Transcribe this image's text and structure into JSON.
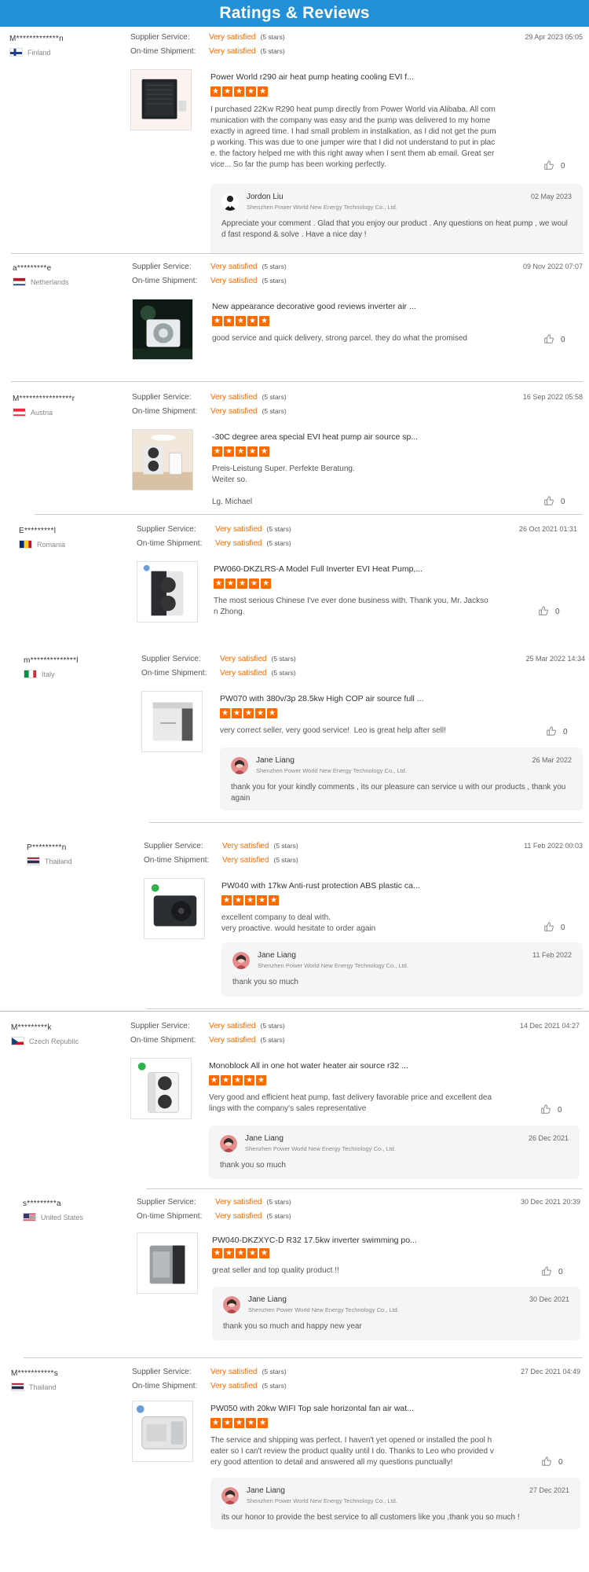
{
  "header": {
    "title": "Ratings & Reviews"
  },
  "common": {
    "supplier_label": "Supplier Service:",
    "shipment_label": "On-time Shipment:",
    "rating_value": "Very satisfied",
    "rating_stars": "(5 stars)",
    "star_count": 5
  },
  "reviews": [
    {
      "user": "M*************n",
      "country": "Finland",
      "date": "29 Apr 2023 05:05",
      "product": "Power World r290 air heat pump heating cooling EVI f...",
      "text": "I purchased 22Kw R290 heat pump directly from Power World via Alibaba. All communication with the company was easy and the pump was delivered to my home exactly in agreed time. I had small problem in instalkation, as I did not get the pump working. This was due to one jumper wire that I did not understand to put in place. the factory helped me with this right away when I sent them ab email. Great service... So far the pump has been working perfectly.",
      "likes": "0",
      "reply": {
        "name": "Jordon Liu",
        "company": "Shenzhen Power World New Energy Technology Co., Ltd.",
        "date": "02 May 2023",
        "text": "Appreciate your comment . Glad that you enjoy our product . Any questions on heat pump , we would fast respond & solve . Have a nice day !"
      }
    },
    {
      "user": "a*********e",
      "country": "Netherlands",
      "date": "09 Nov 2022 07:07",
      "product": "New appearance decorative good reviews inverter air ...",
      "text": "good service and quick delivery, strong parcel. they do what the promised",
      "likes": "0"
    },
    {
      "user": "M****************r",
      "country": "Austria",
      "date": "16 Sep 2022 05:58",
      "product": "-30C degree area special EVI heat pump air source sp...",
      "text": "Preis-Leistung Super. Perfekte Beratung.\nWeiter so.\n\nLg. Michael",
      "likes": "0"
    },
    {
      "user": "E*********l",
      "country": "Romania",
      "date": "26 Oct 2021 01:31",
      "product": "PW060-DKZLRS-A Model Full Inverter EVI Heat Pump,...",
      "text": "The most serious Chinese I've ever done business with. Thank you, Mr. Jackson Zhong.",
      "likes": "0"
    },
    {
      "user": "m**************l",
      "country": "Italy",
      "date": "25 Mar 2022 14:34",
      "product": "PW070 with 380v/3p 28.5kw High COP air source full ...",
      "text": "very correct seller, very good service!  Leo is great help after sell!",
      "likes": "0",
      "reply": {
        "name": "Jane Liang",
        "company": "Shenzhen Power World New Energy Technology Co., Ltd.",
        "date": "26 Mar 2022",
        "text": "thank you for your kindly comments , its our pleasure can service u with our products , thank you again"
      }
    },
    {
      "user": "P*********n",
      "country": "Thailand",
      "date": "11 Feb 2022 00:03",
      "product": "PW040 with 17kw Anti-rust protection ABS plastic ca...",
      "text": "excellent company to deal with.\nvery proactive. would hesitate to order again",
      "likes": "0",
      "reply": {
        "name": "Jane Liang",
        "company": "Shenzhen Power World New Energy Technology Co., Ltd.",
        "date": "11 Feb 2022",
        "text": "thank you so much"
      }
    },
    {
      "user": "M*********k",
      "country": "Czech Republic",
      "date": "14 Dec 2021 04:27",
      "product": "Monoblock All in one hot water heater air source r32 ...",
      "text": "Very good and efficient heat pump, fast delivery favorable price and excellent dealings with the company's sales representative",
      "likes": "0",
      "reply": {
        "name": "Jane Liang",
        "company": "Shenzhen Power World New Energy Technology Co., Ltd.",
        "date": "26 Dec 2021",
        "text": "thank you so much"
      }
    },
    {
      "user": "s*********a",
      "country": "United States",
      "date": "30 Dec 2021 20:39",
      "product": "PW040-DKZXYC-D R32 17.5kw inverter swimming po...",
      "text": "great seller and top quality product !!",
      "likes": "0",
      "reply": {
        "name": "Jane Liang",
        "company": "Shenzhen Power World New Energy Technology Co., Ltd.",
        "date": "30 Dec 2021",
        "text": "thank you so much and happy new year"
      }
    },
    {
      "user": "M***********s",
      "country": "Thailand",
      "date": "27 Dec 2021 04:49",
      "product": "PW050 with 20kw WIFI Top sale horizontal fan air wat...",
      "text": "The service and shipping was perfect. I haven't yet opened or installed the pool heater so I can't review the product quality until I do. Thanks to Leo who provided very good attention to detail and answered all my questions punctually!",
      "likes": "0",
      "reply": {
        "name": "Jane Liang",
        "company": "Shenzhen Power World New Energy Technology Co., Ltd.",
        "date": "27 Dec 2021",
        "text": "its our honor to provide the best service to all customers like you ,thank you so  much !"
      }
    }
  ]
}
